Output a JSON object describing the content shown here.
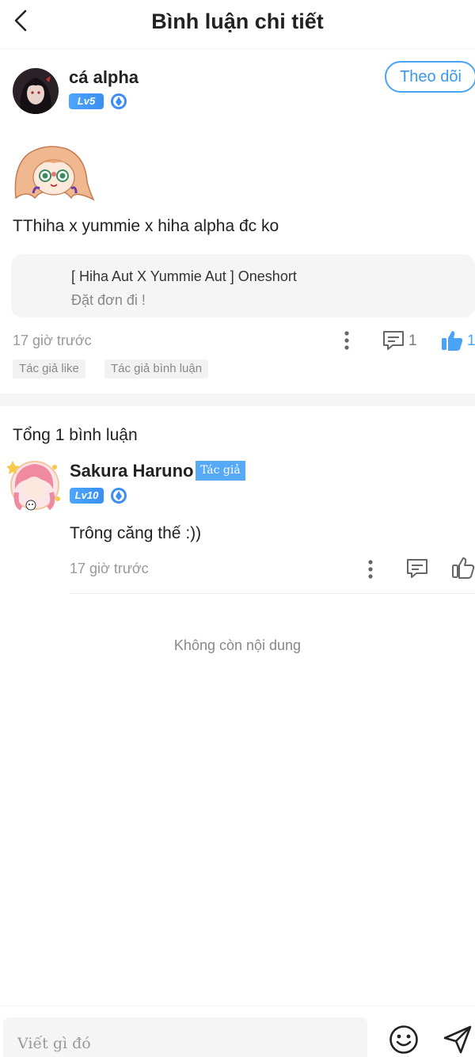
{
  "header": {
    "title": "Bình luận chi tiết"
  },
  "post": {
    "username": "cá alpha",
    "level": "Lv5",
    "follow_label": "Theo dõi",
    "text": "TThiha x yummie x hiha alpha đc ko",
    "quote": {
      "title": "[ Hiha Aut X Yummie Aut ] Oneshort",
      "subtitle": "Đặt đơn đi !"
    },
    "time": "17 giờ trước",
    "comment_count": "1",
    "like_count": "1",
    "tags": [
      "Tác giả like",
      "Tác giả bình luận"
    ]
  },
  "replies_section": {
    "total_label": "Tổng 1 bình luận",
    "replies": [
      {
        "username": "Sakura Haruno",
        "author_badge": "Tác giả",
        "level": "Lv10",
        "text": "Trông căng thế :))",
        "time": "17 giờ trước"
      }
    ],
    "end_label": "Không còn nội dung"
  },
  "composer": {
    "placeholder": "Viết gì đó"
  },
  "colors": {
    "accent": "#3a98ee",
    "like": "#4aa3f5",
    "badge": "#56aaf5"
  },
  "icons": [
    "back-arrow-icon",
    "verified-icon",
    "more-icon",
    "comment-icon",
    "like-icon",
    "emoji-icon",
    "send-icon"
  ]
}
